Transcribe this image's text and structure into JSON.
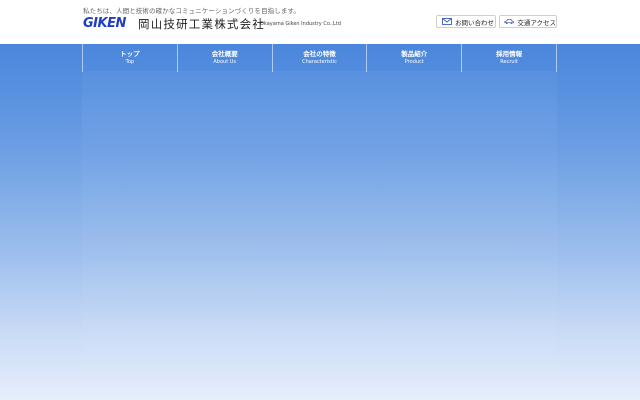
{
  "header": {
    "tagline": "私たちは、人間と技術の確かなコミュニケーションづくりを目指します。",
    "logo_text": "GIKEN",
    "company_name_jp": "岡山技研工業株式会社",
    "company_name_en": "Okayama Giken Industry Co.,Ltd",
    "contact_button": {
      "label": "お問い合わせ",
      "icon": "mail-icon"
    },
    "access_button": {
      "label": "交通アクセス",
      "icon": "car-icon"
    }
  },
  "nav": {
    "items": [
      {
        "label_jp": "トップ",
        "label_en": "Top"
      },
      {
        "label_jp": "会社概要",
        "label_en": "About Us"
      },
      {
        "label_jp": "会社の特徴",
        "label_en": "Characteristic"
      },
      {
        "label_jp": "製品紹介",
        "label_en": "Product"
      },
      {
        "label_jp": "採用情報",
        "label_en": "Recruit"
      }
    ]
  },
  "colors": {
    "brand": "#1e3fc0",
    "nav_gradient_top": "#4a86dc",
    "nav_gradient_bottom": "#e6eefb"
  }
}
